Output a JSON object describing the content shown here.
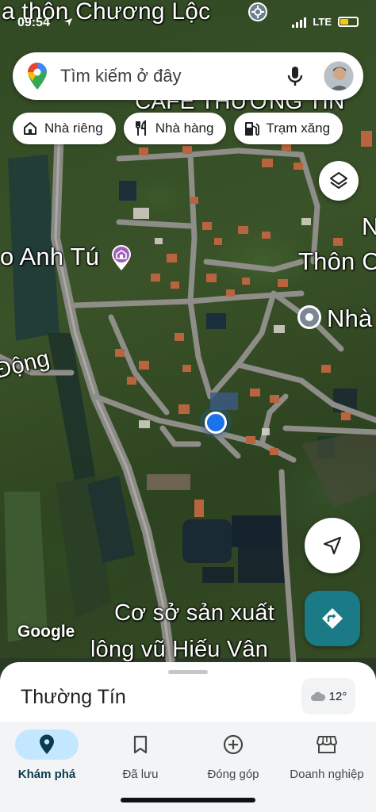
{
  "status_bar": {
    "time": "09:54",
    "network": "LTE"
  },
  "search": {
    "placeholder": "Tìm kiếm ở đây"
  },
  "chips": [
    {
      "label": "Nhà riêng",
      "icon": "home-icon"
    },
    {
      "label": "Nhà hàng",
      "icon": "restaurant-icon"
    },
    {
      "label": "Trạm xăng",
      "icon": "gas-station-icon"
    }
  ],
  "map_labels": {
    "top_village": "a thôn Chương Lộc",
    "cafe": "CAFE THƯỜNG TÍN",
    "anh_tu": "o Anh Tú",
    "thon": "Thôn C",
    "nha": "Nhà",
    "dong": "Động",
    "n_edge": "N",
    "factory_line1": "Cơ sở sản xuất",
    "factory_line2": "lông vũ Hiếu Vân",
    "google": "Google"
  },
  "sheet": {
    "place_name": "Thường Tín",
    "weather_temp": "12°"
  },
  "nav": [
    {
      "label": "Khám phá",
      "icon": "explore-pin-icon",
      "active": true
    },
    {
      "label": "Đã lưu",
      "icon": "bookmark-icon",
      "active": false
    },
    {
      "label": "Đóng góp",
      "icon": "add-circle-icon",
      "active": false
    },
    {
      "label": "Doanh nghiệp",
      "icon": "storefront-icon",
      "active": false
    }
  ],
  "colors": {
    "accent_blue": "#1a73e8",
    "directions_teal": "#1a7a86",
    "active_nav_bg": "#c2e7ff"
  }
}
